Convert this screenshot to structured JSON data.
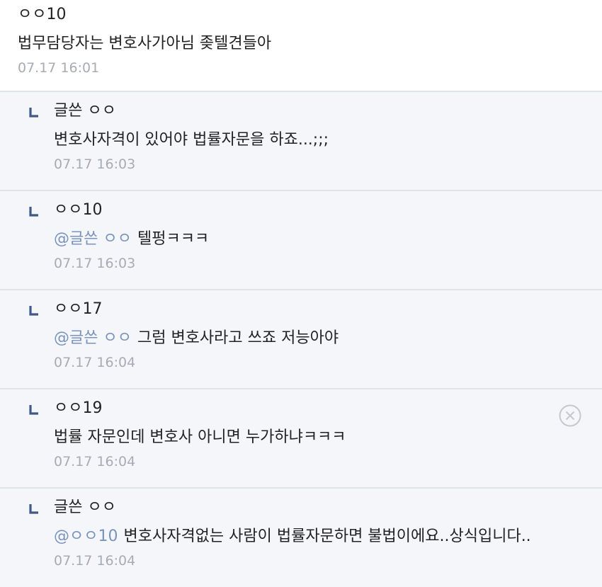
{
  "comments": [
    {
      "author": "ㅇㅇ10",
      "text": "법무담당자는 변호사가아님 좆텔견들아",
      "time": "07.17 16:01"
    },
    {
      "author": "글쓴 ㅇㅇ",
      "text": "변호사자격이 있어야 법률자문을 하죠...;;;",
      "time": "07.17 16:03"
    },
    {
      "author": "ㅇㅇ10",
      "mention": "@글쓴 ㅇㅇ",
      "text": "텔펑ㅋㅋㅋ",
      "time": "07.17 16:03"
    },
    {
      "author": "ㅇㅇ17",
      "mention": "@글쓴 ㅇㅇ",
      "text": "그럼 변호사라고 쓰죠 저능아야",
      "time": "07.17 16:04"
    },
    {
      "author": "ㅇㅇ19",
      "text": "법률 자문인데 변호사 아니면 누가하냐ㅋㅋㅋ",
      "time": "07.17 16:04"
    },
    {
      "author": "글쓴 ㅇㅇ",
      "mention": "@ㅇㅇ10",
      "text": "변호사자격없는 사람이 법률자문하면 불법이에요..상식입니다..",
      "time": "07.17 16:04"
    }
  ],
  "icons": {
    "reply": "reply-arrow-icon",
    "delete": "delete-circle-x-icon"
  },
  "colors": {
    "mention": "#7a93bd",
    "reply_bg": "#f4f6f9",
    "time": "#a7acb4",
    "reply_arrow": "#3f5a8a"
  }
}
